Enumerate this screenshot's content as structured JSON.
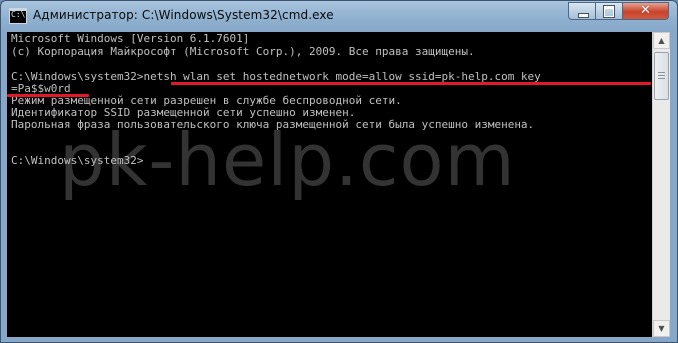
{
  "window": {
    "title": "Администратор: C:\\Windows\\System32\\cmd.exe",
    "icon": "console-icon",
    "icon_glyph": "C:\\",
    "controls": {
      "minimize_icon": "minimize-icon",
      "maximize_icon": "maximize-icon",
      "close_icon": "close-icon",
      "close_glyph": "✕"
    }
  },
  "console": {
    "lines": [
      "Microsoft Windows [Version 6.1.7601]",
      "(c) Корпорация Майкрософт (Microsoft Corp.), 2009. Все права защищены.",
      "",
      "C:\\Windows\\system32>netsh wlan set hostednetwork mode=allow ssid=pk-help.com key",
      "=Pa$$w0rd",
      "Режим размещенной сети разрешен в службе беспроводной сети.",
      "Идентификатор SSID размещенной сети успешно изменен.",
      "Парольная фраза пользовательского ключа размещенной сети была успешно изменена.",
      "",
      "C:\\Windows\\system32>"
    ],
    "watermark": "pk-help.com",
    "highlight_color": "#e3192b",
    "text_color": "#c0c0c0",
    "background": "#000000"
  },
  "scrollbar": {
    "up_glyph": "▲",
    "down_glyph": "▼"
  }
}
